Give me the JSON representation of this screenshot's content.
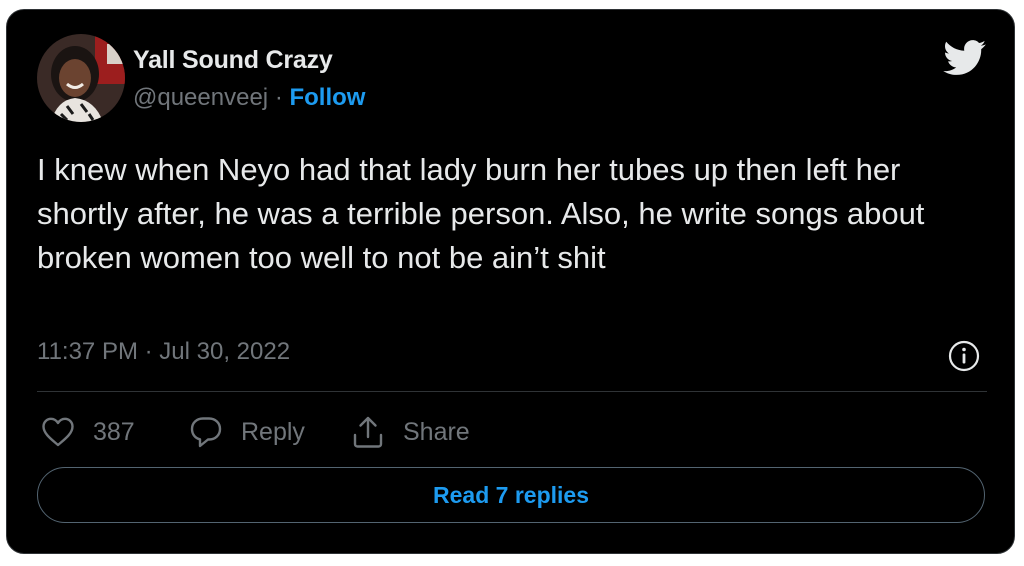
{
  "author": {
    "name": "Yall Sound Crazy",
    "handle": "@queenveej",
    "separator": "·",
    "follow_label": "Follow"
  },
  "tweet": {
    "text": "I knew when Neyo had that lady burn her tubes up then left her shortly after, he was a terrible person. Also, he write songs about broken women too well to not be ain’t shit",
    "time": "11:37 PM",
    "separator": "·",
    "date": "Jul 30, 2022"
  },
  "actions": {
    "like_count": "387",
    "reply_label": "Reply",
    "share_label": "Share"
  },
  "read_replies_label": "Read 7 replies",
  "icons": {
    "brand": "twitter-bird-icon",
    "info": "info-icon",
    "like": "heart-icon",
    "reply": "speech-bubble-icon",
    "share": "share-upload-icon"
  },
  "colors": {
    "background": "#000000",
    "text": "#e7e9ea",
    "muted": "#71767b",
    "accent": "#1d9bf0",
    "border": "#2f3336"
  }
}
